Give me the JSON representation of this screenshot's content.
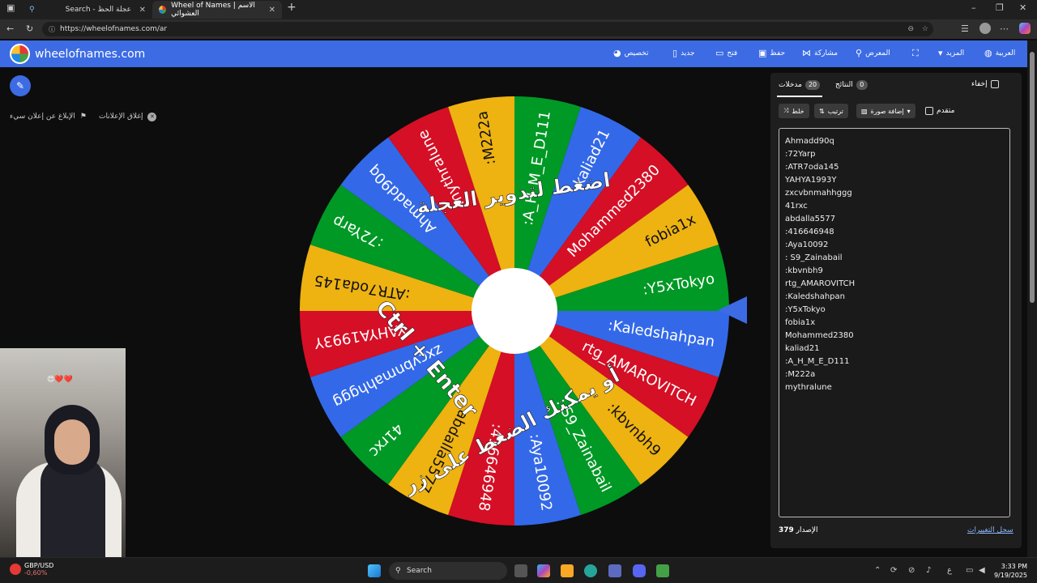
{
  "browser": {
    "tabs": [
      {
        "label": "Search - عجلة الحظ"
      },
      {
        "label": "Wheel of Names | الاسم العشوائي"
      }
    ],
    "url": "https://wheelofnames.com/ar"
  },
  "app": {
    "brand": "wheelofnames.com",
    "menu": {
      "customize": "تخصيص",
      "new": "جديد",
      "open": "فتح",
      "save": "حفظ",
      "share": "مشاركة",
      "gallery": "المعرض",
      "more": "المزيد",
      "language": "العربية"
    }
  },
  "ads": {
    "close_ads": "إغلاق الإعلانات",
    "report_ad": "الإبلاغ عن إعلان سيء"
  },
  "wheel": {
    "overlay_line1": "اضغط لتدوير العجلة",
    "overlay_line2": "أو يمكنك الضغط على زر",
    "overlay_keys": "Ctrl + Enter",
    "colors": [
      "#3369e8",
      "#d50f25",
      "#eeb211",
      "#009925"
    ],
    "segments": [
      ":Kaledshahpan",
      "rtg_AMAROVITCH",
      ":kbvnbh9",
      ": S9_Zainabail",
      ":Aya10092",
      ":416646948",
      "abdalla5577",
      "41rxc",
      "zxcvbnmahhggg",
      "YAHYA1993Y",
      ":ATR7oda145",
      ":72Yarp",
      "Ahmadd90q",
      "mythralune",
      ":M222a",
      ":A_H_M_E_D111",
      "kaliad21",
      "Mohammed2380",
      "fobia1x",
      ":Y5xTokyo"
    ]
  },
  "panel": {
    "entries_tab": "مدخلات",
    "entries_count": "20",
    "results_tab": "النتائج",
    "results_count": "0",
    "hide_label": "إخفاء",
    "shuffle": "خلط",
    "sort": "ترتيب",
    "add_image": "إضافة صورة",
    "advanced": "متقدم",
    "entries": [
      "Ahmadd90q",
      ":72Yarp",
      ":ATR7oda145",
      "YAHYA1993Y",
      "zxcvbnmahhggg",
      "41rxc",
      "abdalla5577",
      ":416646948",
      ":Aya10092",
      ": S9_Zainabail",
      ":kbvnbh9",
      "rtg_AMAROVITCH",
      ":Kaledshahpan",
      ":Y5xTokyo",
      "fobia1x",
      "Mohammed2380",
      "kaliad21",
      ":A_H_M_E_D111",
      ":M222a",
      "mythralune"
    ],
    "version_label": "الإصدار",
    "version": "379",
    "changelog": "سجل التغييرات"
  },
  "taskbar": {
    "ticker_pair": "GBP/USD",
    "ticker_change": "-0,60%",
    "search": "Search",
    "time": "3:33 PM",
    "date": "9/19/2025",
    "lang": "ع"
  }
}
